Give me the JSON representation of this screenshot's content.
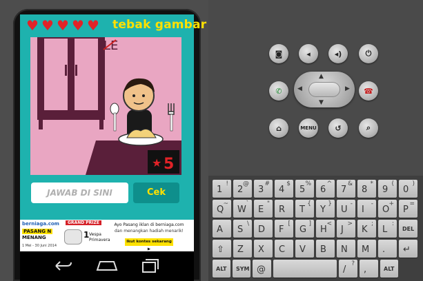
{
  "game": {
    "lives": 5,
    "title": "tebak gambar",
    "star_count": "5",
    "star_symbol": "★",
    "picture_text": "LE",
    "answer_placeholder": "JAWAB DI SINI",
    "submit_label": "Cek"
  },
  "ad": {
    "brand": "berniaga.com",
    "slogan_line1": "PASANG N",
    "slogan_line2": "MENANG",
    "period": "1 Mei - 30 Juni 2014",
    "grand_prize": "GRAND PRIZE",
    "prize_qty": "1",
    "prize_name_1": "Vespa",
    "prize_name_2": "Primavera",
    "headline": "Ayo Pasang iklan di berniaga.com",
    "subline": "dan menangkan hadiah menarik!",
    "cta": "Ikut kontes sekarang ▶"
  },
  "colors": {
    "screen_bg": "#1eb2ae",
    "heart": "#e22227",
    "title": "#ffe100",
    "picture_bg": "#e9a6c2",
    "cabinet": "#5a1f3a",
    "cek_bg": "#0e8f8c"
  },
  "emulator": {
    "top_buttons": [
      "camera-icon",
      "volume-down-icon",
      "volume-up-icon",
      "power-icon"
    ],
    "menu_label": "MENU",
    "keyboard": {
      "row1": [
        [
          "1",
          "!"
        ],
        [
          "2",
          "@"
        ],
        [
          "3",
          "#"
        ],
        [
          "4",
          "$"
        ],
        [
          "5",
          "%"
        ],
        [
          "6",
          "^"
        ],
        [
          "7",
          "&"
        ],
        [
          "8",
          "*"
        ],
        [
          "9",
          "("
        ],
        [
          "0",
          ")"
        ]
      ],
      "row2": [
        [
          "Q",
          "~"
        ],
        [
          "W",
          "`"
        ],
        [
          "E",
          "\""
        ],
        [
          "R",
          ""
        ],
        [
          "T",
          "{"
        ],
        [
          "Y",
          "}"
        ],
        [
          "U",
          "-"
        ],
        [
          "I",
          "-"
        ],
        [
          "O",
          "+"
        ],
        [
          "P",
          "="
        ]
      ],
      "row3": [
        [
          "A",
          ""
        ],
        [
          "S",
          "\\"
        ],
        [
          "D",
          ""
        ],
        [
          "F",
          "["
        ],
        [
          "G",
          "]"
        ],
        [
          "H",
          "<"
        ],
        [
          "J",
          ">"
        ],
        [
          "K",
          ";"
        ],
        [
          "L",
          ":"
        ],
        [
          "DEL",
          ""
        ]
      ],
      "row4": [
        [
          "⇧",
          ""
        ],
        [
          "Z",
          ""
        ],
        [
          "X",
          ""
        ],
        [
          "C",
          ""
        ],
        [
          "V",
          ""
        ],
        [
          "B",
          ""
        ],
        [
          "N",
          ""
        ],
        [
          "M",
          ""
        ],
        [
          ".",
          ""
        ],
        [
          "↵",
          ""
        ]
      ],
      "row5": [
        [
          "ALT",
          ""
        ],
        [
          "SYM",
          ""
        ],
        [
          "@",
          ""
        ],
        [
          "space",
          ""
        ],
        [
          "/",
          "?"
        ],
        [
          ",",
          ""
        ],
        [
          "ALT",
          ""
        ]
      ]
    }
  }
}
